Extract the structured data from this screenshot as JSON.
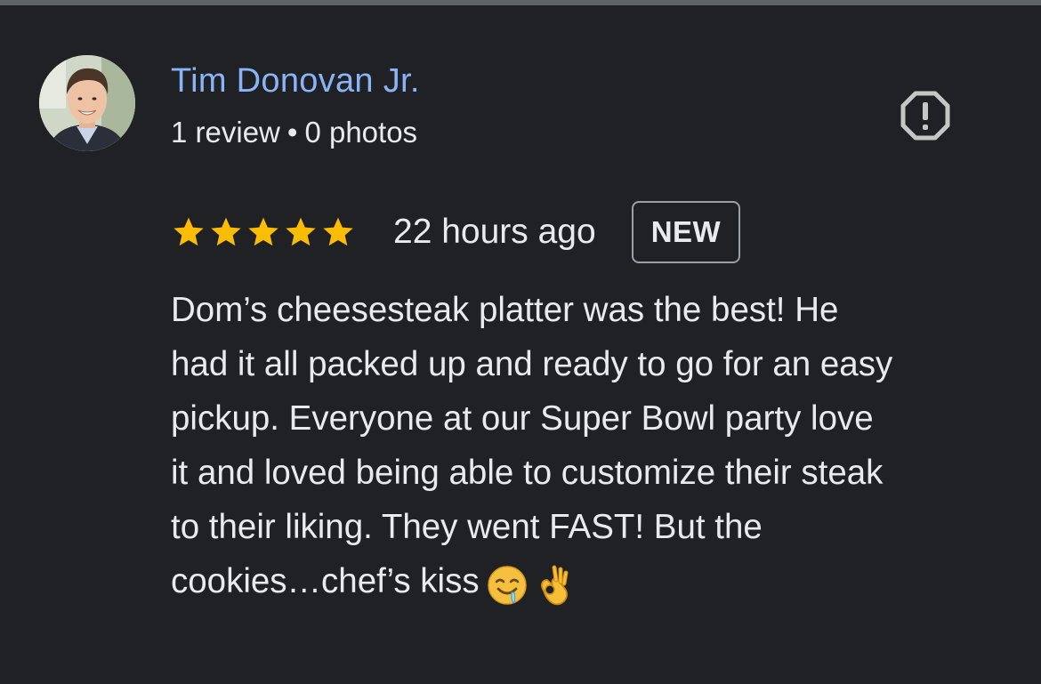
{
  "reviewer": {
    "name": "Tim Donovan Jr.",
    "review_count": "1 review",
    "separator": "•",
    "photo_count": "0 photos"
  },
  "rating": {
    "stars": 5,
    "max_stars": 5,
    "timestamp": "22 hours ago",
    "badge": "NEW"
  },
  "review": {
    "lines": [
      "Dom’s cheesesteak platter was the best! He",
      "had it all packed up and ready to go for an easy",
      "pickup. Everyone at our Super Bowl party love",
      "it and loved being able to customize their steak",
      "to their liking. They went FAST! But the",
      "cookies…chef’s kiss"
    ],
    "emojis": [
      "drooling-face",
      "ok-hand"
    ]
  },
  "icons": {
    "report": "report-octagon-icon",
    "star": "star-icon"
  },
  "colors": {
    "background": "#202124",
    "name_link": "#8ab4f8",
    "text": "#e8eaed",
    "star": "#fbbc04",
    "badge_border": "#9aa0a6"
  }
}
